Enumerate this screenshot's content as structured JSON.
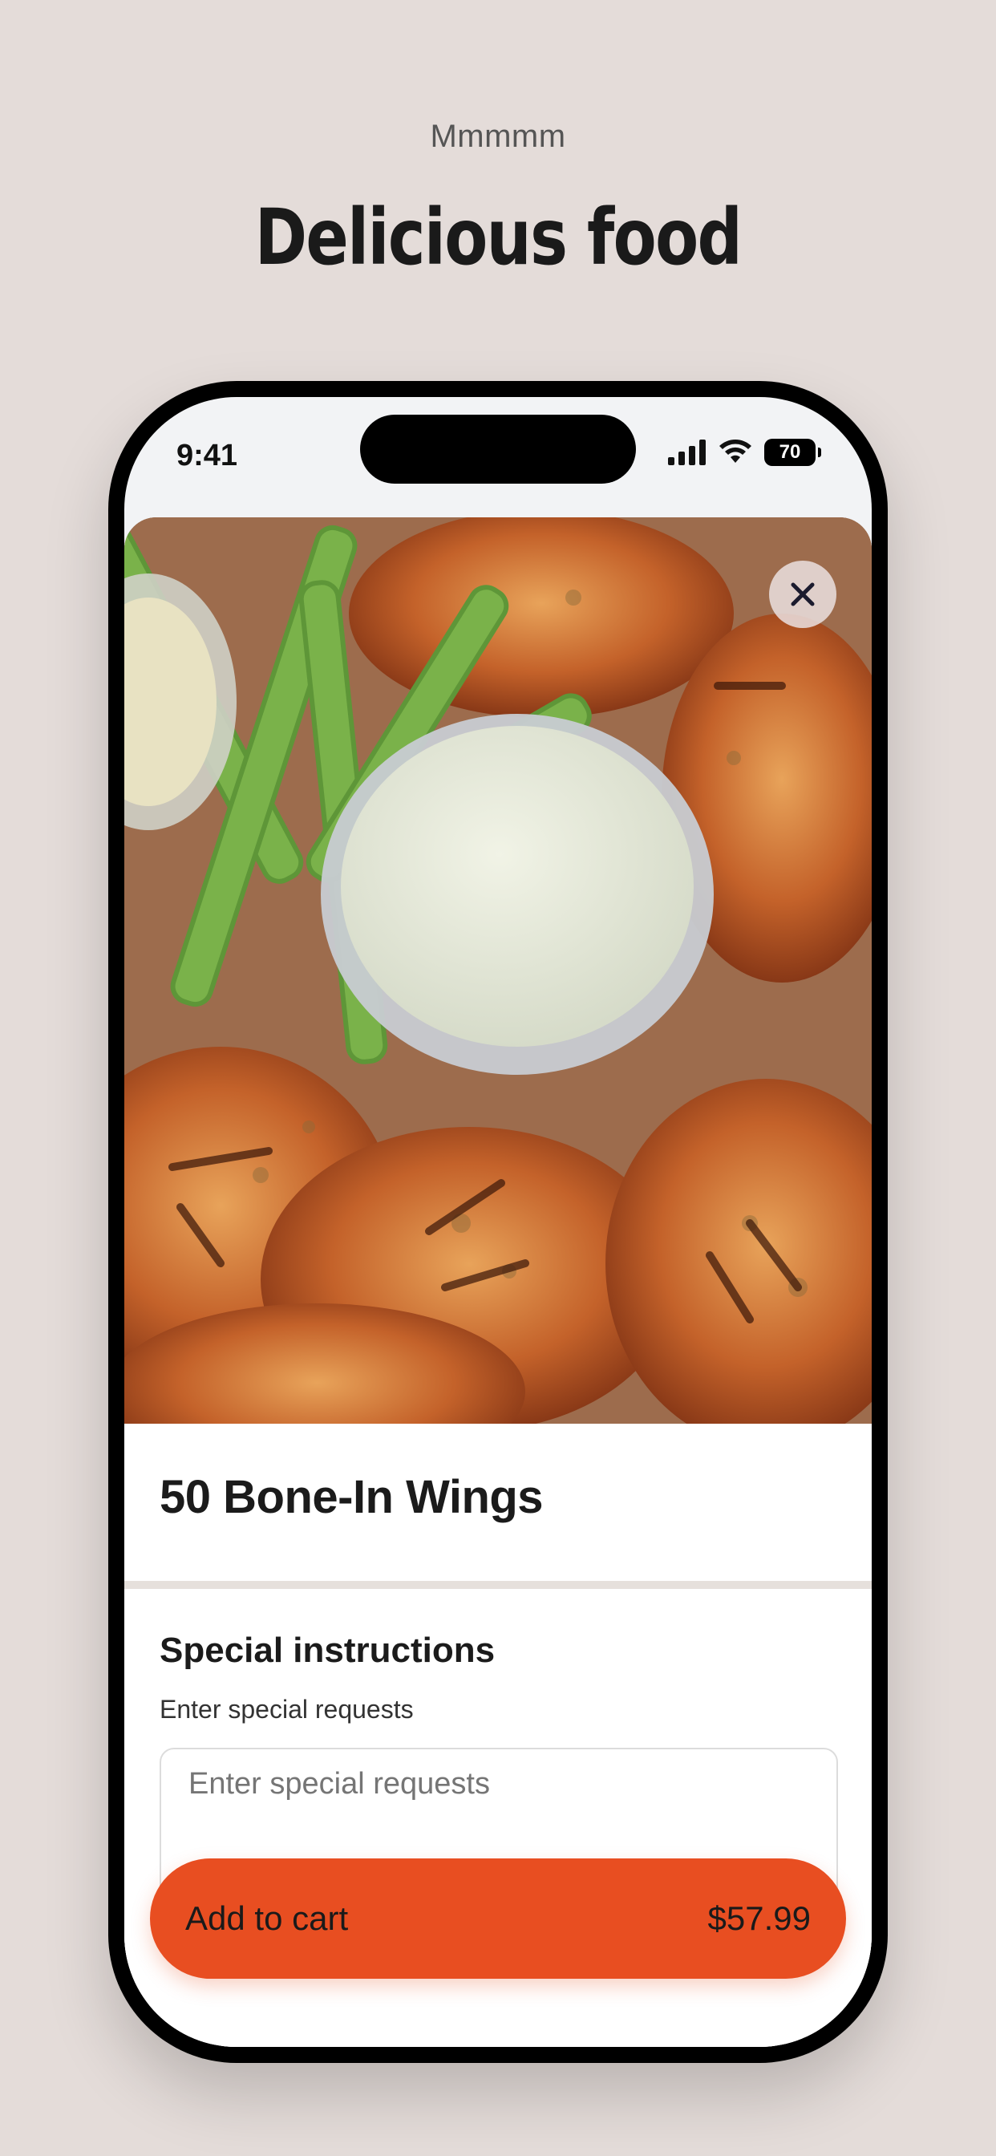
{
  "header": {
    "eyebrow": "Mmmmm",
    "headline": "Delicious food"
  },
  "status_bar": {
    "time": "9:41",
    "battery": "70"
  },
  "item": {
    "image_icon": "food-photo-buffalo-wings",
    "title": "50 Bone-In Wings"
  },
  "instructions": {
    "title": "Special instructions",
    "subtitle": "Enter special requests",
    "placeholder": "Enter special requests"
  },
  "cart": {
    "label": "Add to cart",
    "price": "$57.99"
  },
  "colors": {
    "background": "#e4dcd9",
    "accent": "#e84e21"
  }
}
